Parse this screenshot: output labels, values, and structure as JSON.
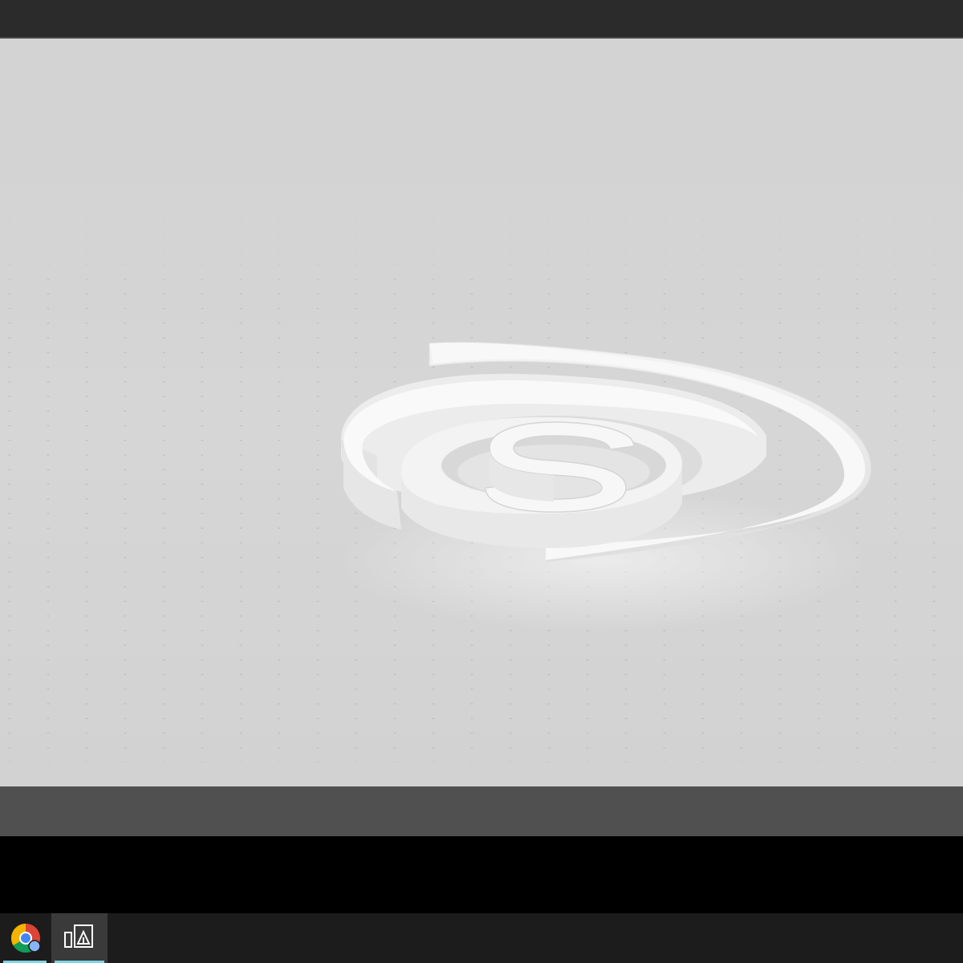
{
  "window": {
    "colors": {
      "title_bar": "#2b2b2b",
      "viewport_background": "#d6d6d6",
      "model": "#f2f2f2",
      "bottom_panel": "#505050",
      "taskbar": "#1c1c1c",
      "taskbar_active": "#3a3a3a",
      "taskbar_indicator": "#7fd3e6"
    }
  },
  "viewport": {
    "content": "3d-print-preview",
    "model_icon": "spiral-s-logo-model-icon"
  },
  "taskbar": {
    "items": [
      {
        "icon": "chrome-icon",
        "active": false,
        "running": true
      },
      {
        "icon": "3d-builder-app-icon",
        "active": true,
        "running": true
      }
    ]
  }
}
